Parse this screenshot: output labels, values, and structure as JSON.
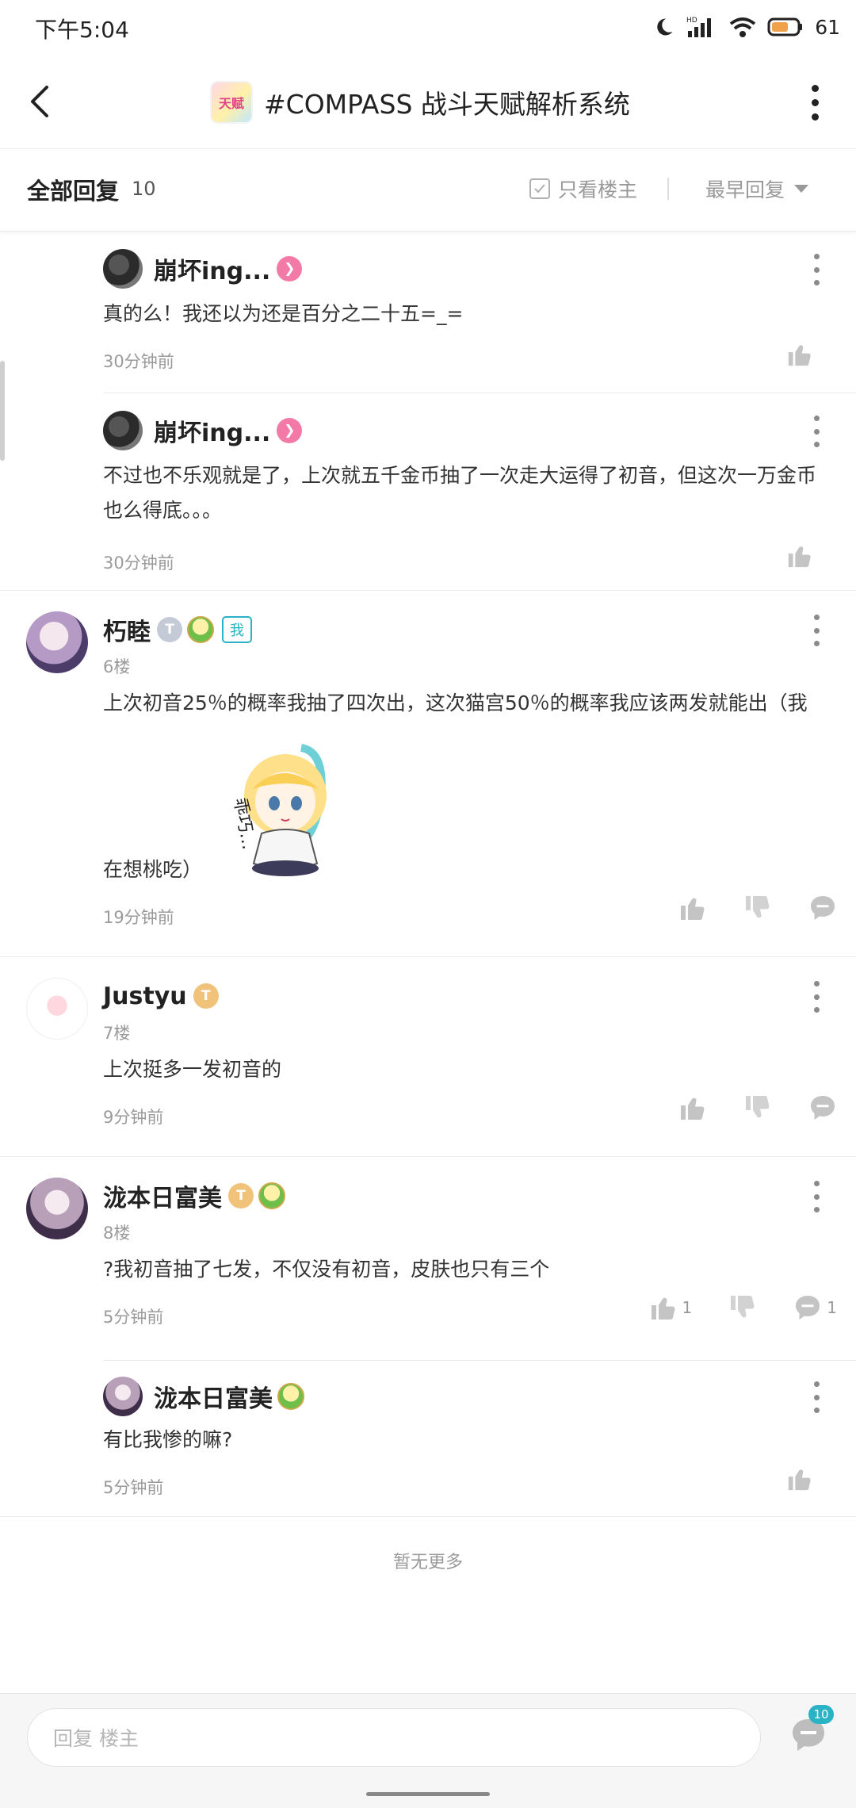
{
  "status_bar": {
    "time": "下午5:04",
    "battery": "61"
  },
  "header": {
    "title": "#COMPASS 战斗天赋解析系统",
    "game_icon_text": "天赋"
  },
  "reply_bar": {
    "title": "全部回复",
    "count": "10",
    "only_op_label": "只看楼主",
    "sort_label": "最早回复"
  },
  "replies": [
    {
      "author": "崩坏ing...",
      "text": "真的么！我还以为还是百分之二十五=_=",
      "time": "30分钟前"
    },
    {
      "author": "崩坏ing...",
      "text": "不过也不乐观就是了，上次就五千金币抽了一次走大运得了初音，但这次一万金币也么得底。。。",
      "time": "30分钟前"
    }
  ],
  "floors": [
    {
      "author": "朽睦",
      "floor": "6楼",
      "me_tag": "我",
      "badge": "T",
      "text_1": "上次初音25％的概率我抽了四次出，这次猫宫50％的概率我应该两发就能出（我",
      "sticker_text": "乖巧…",
      "text_2": "在想桃吃）",
      "time": "19分钟前"
    },
    {
      "author": "Justyu",
      "floor": "7楼",
      "badge": "T",
      "text": "上次挺多一发初音的",
      "time": "9分钟前"
    },
    {
      "author": "泷本日富美",
      "floor": "8楼",
      "badge": "T",
      "text": "?我初音抽了七发，不仅没有初音，皮肤也只有三个",
      "time": "5分钟前",
      "like_count": "1",
      "comment_count": "1",
      "sub_reply": {
        "author": "泷本日富美",
        "text": "有比我惨的嘛?",
        "time": "5分钟前"
      }
    }
  ],
  "footer": {
    "no_more": "暂无更多",
    "input_placeholder": "回复  楼主",
    "comment_badge": "10"
  },
  "colors": {
    "accent": "#2ab3c4",
    "badge_pink": "#f37aa7",
    "text_gray": "#9a9a9a"
  }
}
